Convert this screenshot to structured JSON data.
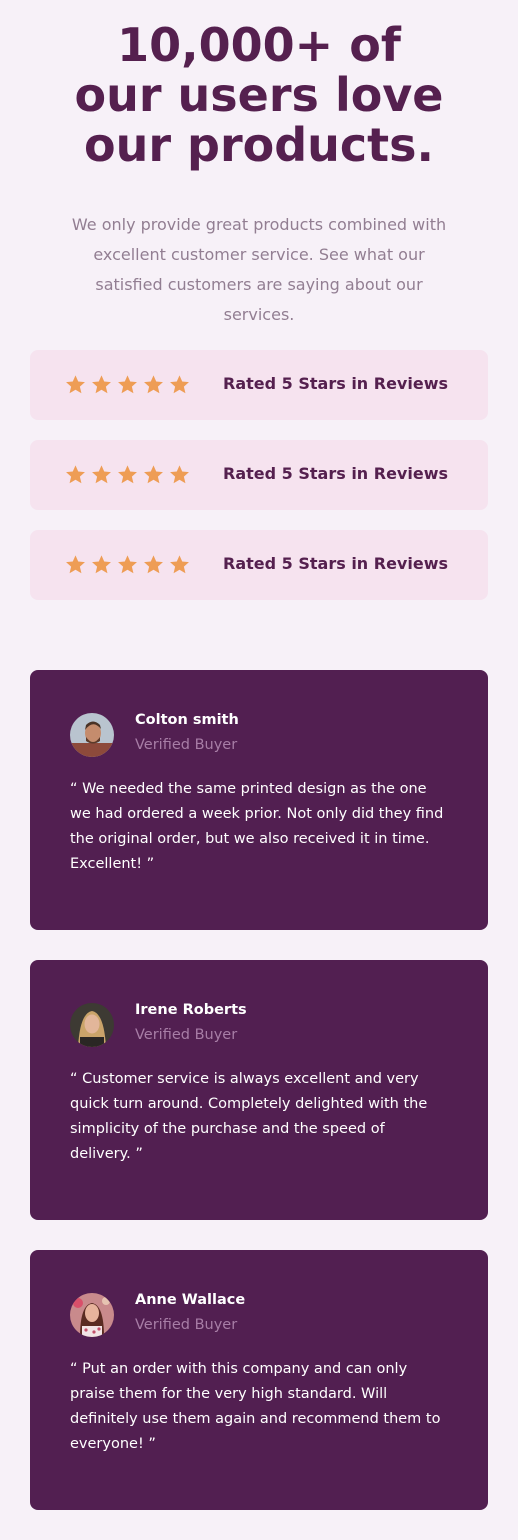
{
  "hero": {
    "title_line1": "10,000+ of",
    "title_line2": "our users love",
    "title_line3": "our products.",
    "subtitle": "We only provide great products combined with excellent customer service. See what our satisfied customers are saying about our services."
  },
  "ratings": [
    {
      "stars": 5,
      "label": "Rated 5 Stars in Reviews"
    },
    {
      "stars": 5,
      "label": "Rated 5 Stars in Reviews"
    },
    {
      "stars": 5,
      "label": "Rated 5 Stars in Reviews"
    }
  ],
  "reviews": [
    {
      "name": "Colton smith",
      "badge": "Verified Buyer",
      "quote": "“ We needed the same printed design as the one we had ordered a week prior. Not only did they find the original order, but we also received it in time. Excellent! ”"
    },
    {
      "name": "Irene Roberts",
      "badge": "Verified Buyer",
      "quote": "“ Customer service is always excellent and very quick turn around. Completely delighted with the simplicity of the purchase and the speed of delivery. ”"
    },
    {
      "name": "Anne Wallace",
      "badge": "Verified Buyer",
      "quote": "“ Put an order with this company and can only praise them for the very high standard. Will definitely use them again and recommend them to everyone! ”"
    }
  ],
  "colors": {
    "background": "#f7f1f8",
    "heading": "#55204f",
    "muted_text": "#927e92",
    "rating_card": "#f6e3ef",
    "star": "#ee9d55",
    "review_card": "#521f51",
    "verified_text": "#a77da6"
  },
  "icons": {
    "star": "star-icon",
    "avatar": "avatar"
  }
}
